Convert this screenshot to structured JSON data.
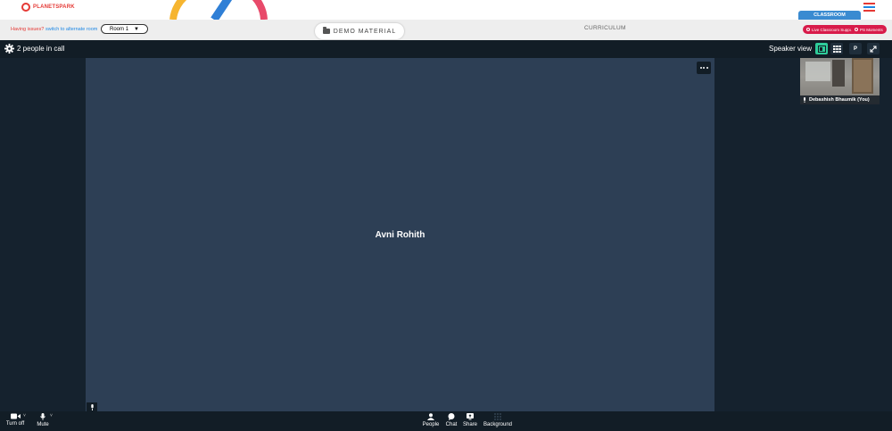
{
  "app": {
    "brand": "PLANETSPARK",
    "classroom_tab": "CLASSROOM"
  },
  "subbar": {
    "issue_text": "Having issues?",
    "issue_link": "switch to alternate room",
    "room_value": "Room 1",
    "demo_material": "DEMO MATERIAL",
    "curriculum": "CURRICULUM",
    "live_support": "Live Classroom Support",
    "ps_moments": "PS Moments"
  },
  "call": {
    "people_count": "2 people in call",
    "view_label": "Speaker view",
    "active_speaker": "Avni Rohith",
    "self_name": "Debashish Bhaumik (You)"
  },
  "toolbar": {
    "camera": "Turn off",
    "mic": "Mute",
    "people": "People",
    "chat": "Chat",
    "share": "Share",
    "background": "Background"
  },
  "colors": {
    "brand_red": "#e53935",
    "accent_blue": "#1e88e5",
    "active_view_green": "#2ecc9a",
    "video_tile": "#2d3f55",
    "call_bg": "#15222e"
  }
}
